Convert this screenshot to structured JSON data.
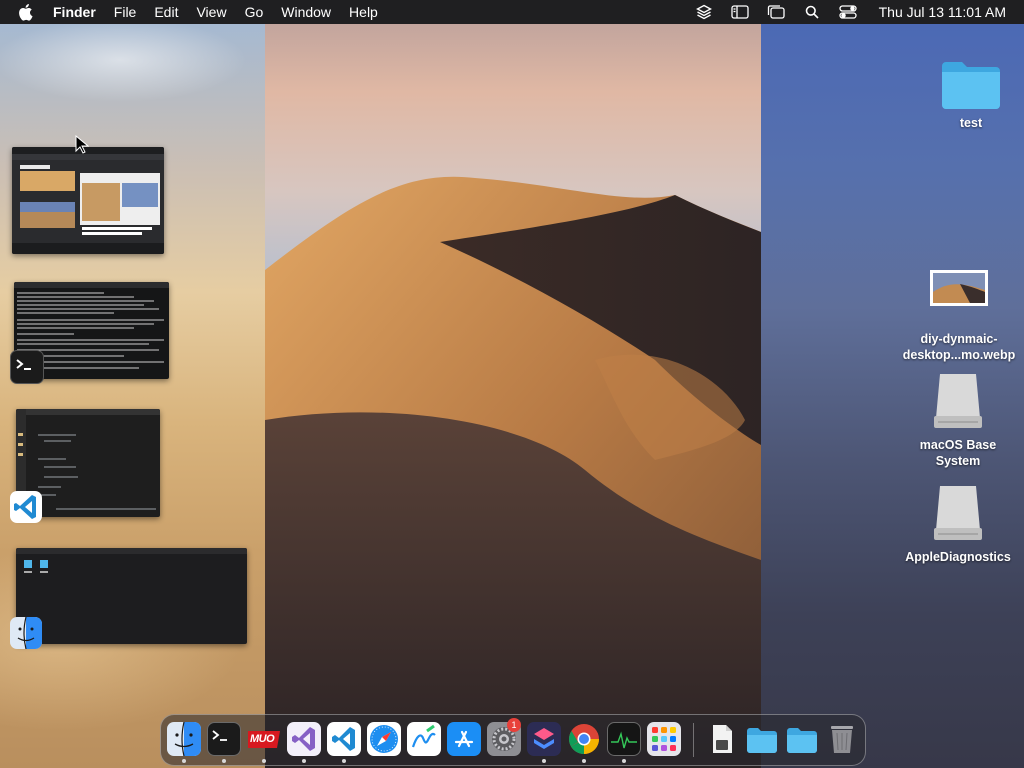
{
  "menubar": {
    "app_name": "Finder",
    "menus": [
      "File",
      "Edit",
      "View",
      "Go",
      "Window",
      "Help"
    ],
    "clock": "Thu Jul 13  11:01 AM",
    "status_icons": [
      "layers-icon",
      "sidebar-icon",
      "stage-manager-icon",
      "search-icon",
      "control-center-icon"
    ]
  },
  "desktop": {
    "items": [
      {
        "label": "test",
        "icon": "folder-icon"
      },
      {
        "label": "diy-dynmaic-desktop...mo.webp",
        "icon": "image-file-icon"
      },
      {
        "label": "macOS Base System",
        "icon": "disk-icon"
      },
      {
        "label": "AppleDiagnostics",
        "icon": "disk-icon"
      }
    ]
  },
  "stage_manager": {
    "windows": [
      {
        "app": "Chrome",
        "icon": "chrome-icon"
      },
      {
        "app": "Terminal",
        "icon": "terminal-icon"
      },
      {
        "app": "Visual Studio Code",
        "icon": "vscode-icon"
      },
      {
        "app": "Finder",
        "icon": "finder-icon"
      }
    ]
  },
  "dock": {
    "apps": [
      {
        "name": "Finder",
        "icon": "finder-icon",
        "running": true
      },
      {
        "name": "Terminal",
        "icon": "terminal-icon",
        "running": true
      },
      {
        "name": "MUO",
        "icon": "muo-icon",
        "running": true,
        "label": "MUO"
      },
      {
        "name": "Visual Studio",
        "icon": "visual-studio-icon",
        "running": true
      },
      {
        "name": "Visual Studio Code",
        "icon": "vscode-icon",
        "running": true
      },
      {
        "name": "Safari",
        "icon": "safari-icon",
        "running": false
      },
      {
        "name": "Freeform",
        "icon": "freeform-icon",
        "running": false
      },
      {
        "name": "App Store",
        "icon": "app-store-icon",
        "running": false
      },
      {
        "name": "System Settings",
        "icon": "settings-icon",
        "running": false,
        "badge": "1"
      },
      {
        "name": "Shortcuts",
        "icon": "shortcuts-icon",
        "running": true
      },
      {
        "name": "Chrome",
        "icon": "chrome-icon",
        "running": true
      },
      {
        "name": "Activity Monitor",
        "icon": "activity-monitor-icon",
        "running": true
      },
      {
        "name": "Launchpad",
        "icon": "launchpad-icon",
        "running": false
      },
      {
        "name": "Downloads",
        "icon": "file-stack-icon",
        "running": false
      },
      {
        "name": "Documents",
        "icon": "folder-icon",
        "running": false
      },
      {
        "name": "Applications",
        "icon": "folder-icon",
        "running": false
      },
      {
        "name": "Trash",
        "icon": "trash-icon",
        "running": false
      }
    ]
  },
  "colors": {
    "menubar_bg": "#1f1f21",
    "dock_bg": "rgba(40,40,46,.55)",
    "folder_blue": "#4fb6ea",
    "badge_red": "#e8403a",
    "vscode_blue": "#1f8ad2"
  }
}
